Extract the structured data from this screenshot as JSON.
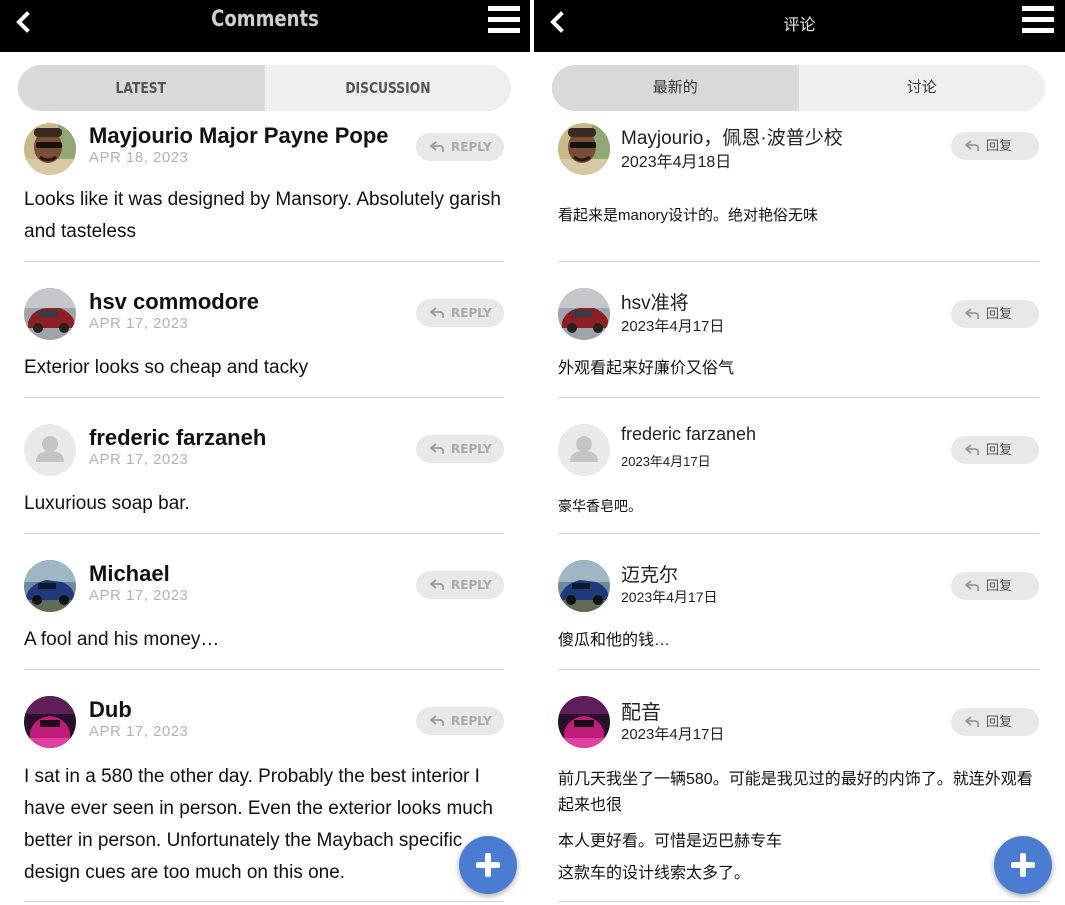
{
  "left": {
    "header": {
      "title": "Comments"
    },
    "tabs": [
      "LATEST",
      "DISCUSSION"
    ],
    "comments": [
      {
        "username": "Mayjourio Major Payne Pope",
        "date": "APR 18, 2023",
        "reply": "REPLY",
        "body": "Looks like it was designed by Mansory. Absolutely garish and tasteless",
        "avatar": "avatar-man-sunglasses"
      },
      {
        "username": "hsv commodore",
        "date": "APR 17, 2023",
        "reply": "REPLY",
        "body": "Exterior looks so cheap and tacky",
        "avatar": "avatar-red-car"
      },
      {
        "username": "frederic farzaneh",
        "date": "APR 17, 2023",
        "reply": "REPLY",
        "body": "Luxurious soap bar.",
        "avatar": "avatar-default-user"
      },
      {
        "username": "Michael",
        "date": "APR 17, 2023",
        "reply": "REPLY",
        "body": "A fool and his money…",
        "avatar": "avatar-blue-car"
      },
      {
        "username": "Dub",
        "date": "APR 17, 2023",
        "reply": "REPLY",
        "body": "I sat in a 580 the other day. Probably the best interior I have ever seen in person. Even the exterior looks much better in person. Unfortunately the Maybach specific design cues are too much on this one.",
        "avatar": "avatar-pink-car"
      }
    ]
  },
  "right": {
    "header": {
      "title": "评论"
    },
    "tabs": [
      "最新的",
      "讨论"
    ],
    "comments": [
      {
        "username": "Mayjourio，佩恩·波普少校",
        "date": "2023年4月18日",
        "reply": "回复",
        "body": "看起来是manory设计的。绝对艳俗无味",
        "avatar": "avatar-man-sunglasses"
      },
      {
        "username": "hsv准将",
        "date": "2023年4月17日",
        "reply": "回复",
        "body": "外观看起来好廉价又俗气",
        "avatar": "avatar-red-car"
      },
      {
        "username": "frederic farzaneh",
        "date": "2023年4月17日",
        "reply": "回复",
        "body": "豪华香皂吧。",
        "avatar": "avatar-default-user"
      },
      {
        "username": "迈克尔",
        "date": "2023年4月17日",
        "reply": "回复",
        "body": "傻瓜和他的钱…",
        "avatar": "avatar-blue-car"
      },
      {
        "username": "配音",
        "date": "2023年4月17日",
        "reply": "回复",
        "body": "前几天我坐了一辆580。可能是我见过的最好的内饰了。就连外观看起来也很",
        "body2": "本人更好看。可惜是迈巴赫专车",
        "body3": "这款车的设计线索太多了。",
        "avatar": "avatar-pink-car"
      }
    ]
  },
  "icons": {
    "back": "chevron-left-icon",
    "menu": "hamburger-menu-icon",
    "reply": "reply-arrow-icon",
    "fab": "plus-icon"
  },
  "colors": {
    "header_bg": "#000000",
    "fab": "#4a7dd1",
    "tab_active": "#d9d9d9",
    "tab_inactive": "#efefef",
    "reply_bg": "#e8e8e8",
    "date_en": "#b3b3b3"
  }
}
